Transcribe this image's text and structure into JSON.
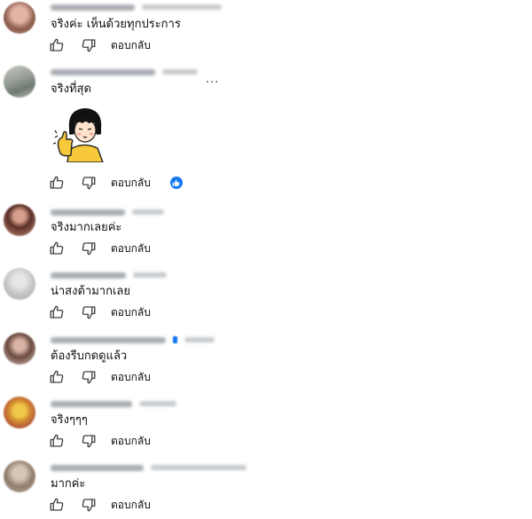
{
  "reply_label": "ตอบกลับ",
  "more_label": "...",
  "colors": {
    "like_badge": "#1877f2",
    "text": "#0f0f0f",
    "icon_stroke": "#404040"
  },
  "comments": [
    {
      "text": "จริงค่ะ เห็นด้วยทุกประการ",
      "liked_by_creator": false
    },
    {
      "text": "จริงที่สุด",
      "has_sticker": true,
      "sticker_icon": "girl-thumbs-up-sticker-icon",
      "liked_by_creator": true
    },
    {
      "text": "จริงมากเลยค่ะ",
      "liked_by_creator": false
    },
    {
      "text": "น่าสงต้ามากเลย",
      "liked_by_creator": false
    },
    {
      "text": "ต้องรีบกดดูแล้ว",
      "liked_by_creator": false
    },
    {
      "text": "จริงๆๆๆ",
      "liked_by_creator": false
    },
    {
      "text": "มากค่ะ",
      "liked_by_creator": false
    }
  ]
}
